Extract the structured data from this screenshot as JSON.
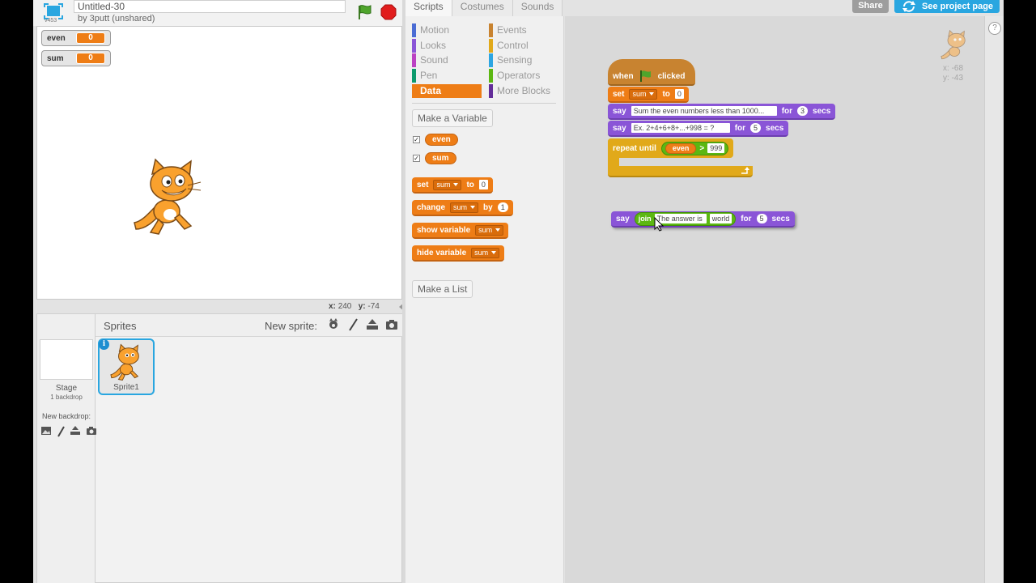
{
  "project": {
    "title": "Untitled-30",
    "byline": "by 3putt (unshared)",
    "version": "v453"
  },
  "stage": {
    "monitors": [
      {
        "label": "even",
        "value": "0"
      },
      {
        "label": "sum",
        "value": "0"
      }
    ],
    "mouse_x_label": "x:",
    "mouse_x": "240",
    "mouse_y_label": "y:",
    "mouse_y": "-74"
  },
  "sprite_pane": {
    "sprites_title": "Sprites",
    "new_sprite_label": "New sprite:",
    "stage_label": "Stage",
    "backdrop_count": "1 backdrop",
    "new_backdrop_label": "New backdrop:",
    "sprites": [
      {
        "name": "Sprite1",
        "info": "i"
      }
    ]
  },
  "tabs": [
    {
      "label": "Scripts",
      "active": true
    },
    {
      "label": "Costumes",
      "active": false
    },
    {
      "label": "Sounds",
      "active": false
    }
  ],
  "categories": [
    {
      "label": "Motion",
      "color": "#4a6cd4"
    },
    {
      "label": "Looks",
      "color": "#8a55d7"
    },
    {
      "label": "Sound",
      "color": "#bb42c3"
    },
    {
      "label": "Pen",
      "color": "#0e9a6c"
    },
    {
      "label": "Data",
      "color": "#ee7d16",
      "selected": true
    },
    {
      "label": "Events",
      "color": "#c88330"
    },
    {
      "label": "Control",
      "color": "#e1a91a"
    },
    {
      "label": "Sensing",
      "color": "#2ca5e2"
    },
    {
      "label": "Operators",
      "color": "#5cb712"
    },
    {
      "label": "More Blocks",
      "color": "#632d99"
    }
  ],
  "palette": {
    "make_variable": "Make a Variable",
    "make_list": "Make a List",
    "variables": [
      "even",
      "sum"
    ],
    "check": "✓",
    "set_block": {
      "label": "set",
      "var": "sum",
      "to": "to",
      "value": "0"
    },
    "change_block": {
      "label": "change",
      "var": "sum",
      "by": "by",
      "value": "1"
    },
    "show_block": {
      "label": "show variable",
      "var": "sum"
    },
    "hide_block": {
      "label": "hide variable",
      "var": "sum"
    }
  },
  "top_buttons": {
    "share": "Share",
    "see_project": "See project page"
  },
  "script": {
    "hat": {
      "when": "when",
      "clicked": "clicked"
    },
    "set": {
      "label": "set",
      "var": "sum",
      "to": "to",
      "value": "0"
    },
    "say1": {
      "label": "say",
      "text": "Sum the even numbers less than 1000...",
      "for": "for",
      "secs_value": "3",
      "secs": "secs"
    },
    "say2": {
      "label": "say",
      "text": "Ex.  2+4+6+8+...+998 = ?",
      "for": "for",
      "secs_value": "5",
      "secs": "secs"
    },
    "repeat": {
      "label": "repeat until",
      "var": "even",
      "op": ">",
      "value": "999"
    },
    "say_join": {
      "label": "say",
      "join": "join",
      "text1": "The answer is ",
      "text2": "world",
      "for": "for",
      "secs_value": "5",
      "secs": "secs"
    }
  },
  "sprite_corner": {
    "x_label": "x:",
    "x": "-68",
    "y_label": "y:",
    "y": "-43"
  },
  "help": "?",
  "colors": {
    "data": "#ee7d16",
    "looks": "#8a55d7",
    "control": "#e1a91a",
    "events": "#c88330",
    "operators": "#5cb712",
    "accent": "#29a6e0"
  }
}
